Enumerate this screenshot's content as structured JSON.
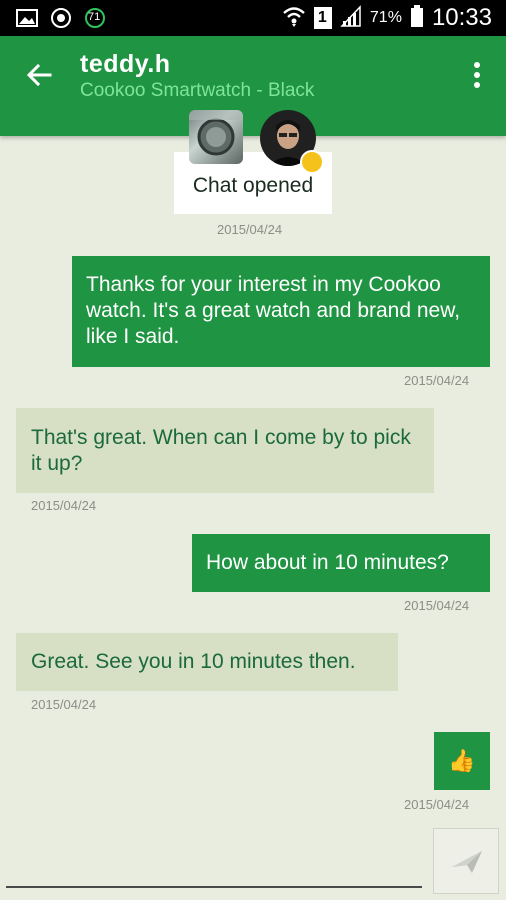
{
  "status_bar": {
    "battery_percent": "71%",
    "time": "10:33",
    "notification_badge": "71",
    "sim_number": "1"
  },
  "header": {
    "title": "teddy.h",
    "subtitle": "Cookoo Smartwatch - Black"
  },
  "chat_opened": {
    "label": "Chat opened",
    "date": "2015/04/24"
  },
  "messages": [
    {
      "direction": "sent",
      "text": "Thanks for your interest in my Cookoo watch. It's a great watch and brand new, like I said.",
      "date": "2015/04/24"
    },
    {
      "direction": "received",
      "text": "That's great. When can I come by to pick it up?",
      "date": "2015/04/24"
    },
    {
      "direction": "sent",
      "text": "How about in 10 minutes?",
      "date": "2015/04/24"
    },
    {
      "direction": "received",
      "text": "Great. See you in 10 minutes then.",
      "date": "2015/04/24"
    },
    {
      "direction": "sent",
      "text": "👍",
      "date": "2015/04/24"
    }
  ],
  "colors": {
    "primary": "#1f9442",
    "accent_text": "#7fe49a",
    "received_bubble": "#d7dfc4",
    "background": "#e9eddf"
  },
  "icons": {
    "back": "arrow-left-icon",
    "menu": "overflow-menu-icon",
    "send": "send-icon"
  }
}
